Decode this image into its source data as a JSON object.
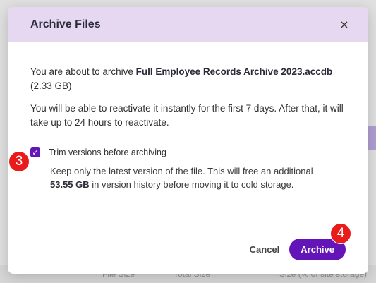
{
  "modal": {
    "title": "Archive Files",
    "close_glyph": "×",
    "intro_prefix": "You are about to archive ",
    "file_name": "Full Employee Records Archive 2023.accdb",
    "file_size": " (2.33 GB)",
    "reactivate_text": "You will be able to reactivate it instantly for the first 7 days. After that, it will take up to 24 hours to reactivate.",
    "trim_option": {
      "checked": true,
      "label": "Trim versions before archiving",
      "desc_prefix": "Keep only the latest version of the file. This will free an additional ",
      "desc_amount": "53.55 GB",
      "desc_suffix": " in version history before moving it to cold storage."
    },
    "cancel_label": "Cancel",
    "archive_label": "Archive"
  },
  "background": {
    "footer_columns": [
      "File Size",
      "Total Size",
      "Size (% of site storage)"
    ]
  },
  "step_badges": [
    "3",
    "4"
  ],
  "colors": {
    "accent": "#6315b8",
    "header_bg": "#e6d8f1",
    "badge": "#ea1b1b"
  }
}
